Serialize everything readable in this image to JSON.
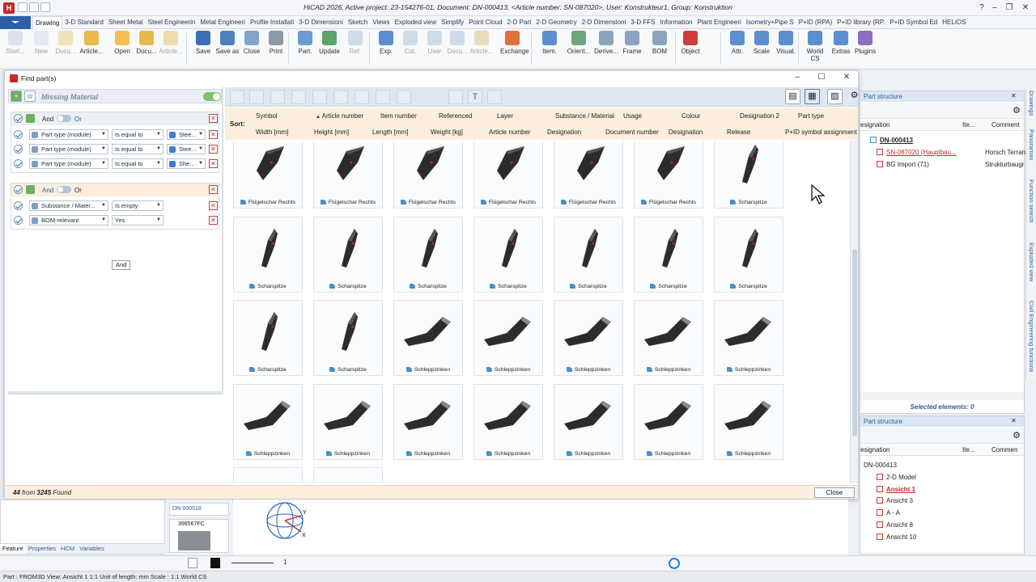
{
  "app": {
    "title": "HiCAD 2026, Active project: 23-154276-01, Document: DN-000413, <Article number: SN-087020>, User: Konstrukteur1, Group: Konstruktion"
  },
  "tabs": [
    {
      "label": "Drawing",
      "active": true
    },
    {
      "label": "3-D Standard"
    },
    {
      "label": "Sheet Metal"
    },
    {
      "label": "Steel Engineerin"
    },
    {
      "label": "Metal Engineeri"
    },
    {
      "label": "Profile Installati"
    },
    {
      "label": "3-D Dimensioni"
    },
    {
      "label": "Sketch"
    },
    {
      "label": "Views"
    },
    {
      "label": "Exploded view"
    },
    {
      "label": "Simplify"
    },
    {
      "label": "Point Cloud"
    },
    {
      "label": "2-D Part"
    },
    {
      "label": "2-D Geometry"
    },
    {
      "label": "2-D Dimensioni"
    },
    {
      "label": "3-D FFS"
    },
    {
      "label": "Information"
    },
    {
      "label": "Plant Engineeri"
    },
    {
      "label": "Isometry+Pipe S"
    },
    {
      "label": "P+ID (RPA)"
    },
    {
      "label": "P+ID library (RP."
    },
    {
      "label": "P+ID Symbol Ed"
    },
    {
      "label": "HELIOS"
    }
  ],
  "ribbon": [
    {
      "label": "Start...",
      "dim": true,
      "color": "#b9c6d6"
    },
    {
      "label": "New",
      "dim": true,
      "color": "#c7d4e3"
    },
    {
      "label": "Docu...",
      "dim": true,
      "color": "#e9c46a"
    },
    {
      "label": "Article...",
      "dim": false,
      "color": "#e9b949"
    },
    {
      "label": "Open",
      "dim": false,
      "color": "#f2c14e"
    },
    {
      "label": "Docu...",
      "dim": false,
      "color": "#e5b94a"
    },
    {
      "label": "Article...",
      "dim": true,
      "color": "#e5b94a"
    },
    {
      "label": "Save",
      "dim": false,
      "color": "#3b6fb6"
    },
    {
      "label": "Save as",
      "dim": false,
      "color": "#4d7fc1"
    },
    {
      "label": "Close",
      "dim": false,
      "color": "#7fa4cf"
    },
    {
      "label": "Print",
      "dim": false,
      "color": "#8e99a6"
    },
    {
      "label": "Part.",
      "dim": false,
      "color": "#6b9bd1"
    },
    {
      "label": "Update",
      "dim": false,
      "color": "#5aa56a"
    },
    {
      "label": "Ref.",
      "dim": true,
      "color": "#9bb7d4"
    },
    {
      "label": "Exp.",
      "dim": false,
      "color": "#5b8fd0"
    },
    {
      "label": "Cat.",
      "dim": true,
      "color": "#9bb7d4"
    },
    {
      "label": "User",
      "dim": true,
      "color": "#9bb7d4"
    },
    {
      "label": "Docu...",
      "dim": true,
      "color": "#9bb7d4"
    },
    {
      "label": "Article...",
      "dim": true,
      "color": "#d6b56a"
    },
    {
      "label": "Exchange",
      "dim": false,
      "color": "#e0713a"
    },
    {
      "label": "Item.",
      "dim": false,
      "color": "#5b8fd0"
    },
    {
      "label": "Orient...",
      "dim": false,
      "color": "#6aa67a"
    },
    {
      "label": "Derive...",
      "dim": false,
      "color": "#8aa3bf"
    },
    {
      "label": "Frame",
      "dim": false,
      "color": "#8aa3bf"
    },
    {
      "label": "BOM",
      "dim": false,
      "color": "#8aa3bf"
    },
    {
      "label": "Object",
      "dim": false,
      "color": "#d23b3b"
    },
    {
      "label": "Attr.",
      "dim": false,
      "color": "#5b8fd0"
    },
    {
      "label": "Scale",
      "dim": false,
      "color": "#5b8fd0"
    },
    {
      "label": "Visual.",
      "dim": false,
      "color": "#5b8fd0"
    },
    {
      "label": "World CS",
      "dim": false,
      "color": "#5b8fd0"
    },
    {
      "label": "Extras",
      "dim": false,
      "color": "#5b8fd0"
    },
    {
      "label": "Plugins",
      "dim": false,
      "color": "#8a6fc0"
    }
  ],
  "findwin": {
    "title": "Find part(s)",
    "panel_title": "Missing Material",
    "group1": {
      "and_label": "And",
      "or_label": "Or",
      "rows": [
        {
          "field": "Part type (module)",
          "op": "Is equal to",
          "value": "Stee..."
        },
        {
          "field": "Part type (module)",
          "op": "Is equal to",
          "value": "Stee..."
        },
        {
          "field": "Part type (module)",
          "op": "Is equal to",
          "value": "She..."
        }
      ]
    },
    "tooltip": "And",
    "group2": {
      "and_label": "And",
      "or_label": "Or",
      "rows": [
        {
          "field": "Substance / Mater...",
          "op": "Is empty",
          "value": ""
        },
        {
          "field": "BOM-relevant",
          "op": "Yes",
          "value": ""
        }
      ]
    },
    "sort": {
      "label": "Sort:",
      "row1": [
        "Symbol",
        "Article number",
        "Item number",
        "Referenced",
        "Layer",
        "Substance / Material",
        "Usage",
        "Colour",
        "Designation 2",
        "Part type"
      ],
      "row2": [
        "Width [mm]",
        "Height [mm]",
        "Length [mm]",
        "Weight [kg]",
        "Article number",
        "Designation",
        "Document number",
        "Designation",
        "Release",
        "P+ID symbol assignment"
      ]
    },
    "results": [
      {
        "label": "Flügelschar Rechts",
        "shape": "wing"
      },
      {
        "label": "Flügelschar Rechts",
        "shape": "wing"
      },
      {
        "label": "Flügelschar Rechts",
        "shape": "wing"
      },
      {
        "label": "Flügelschar Rechts",
        "shape": "wing"
      },
      {
        "label": "Flügelschar Rechts",
        "shape": "wing"
      },
      {
        "label": "Flügelschar Rechts",
        "shape": "wing"
      },
      {
        "label": "Scharspitze",
        "shape": "tip"
      },
      {
        "label": "Scharspitze",
        "shape": "tip"
      },
      {
        "label": "Scharspitze",
        "shape": "tip"
      },
      {
        "label": "Scharspitze",
        "shape": "tip"
      },
      {
        "label": "Scharspitze",
        "shape": "tip"
      },
      {
        "label": "Scharspitze",
        "shape": "tip"
      },
      {
        "label": "Scharspitze",
        "shape": "tip"
      },
      {
        "label": "Scharspitze",
        "shape": "tip"
      },
      {
        "label": "Scharspitze",
        "shape": "tip"
      },
      {
        "label": "Scharspitze",
        "shape": "tip"
      },
      {
        "label": "Schleppzinken",
        "shape": "tine"
      },
      {
        "label": "Schleppzinken",
        "shape": "tine"
      },
      {
        "label": "Schleppzinken",
        "shape": "tine"
      },
      {
        "label": "Schleppzinken",
        "shape": "tine"
      },
      {
        "label": "Schleppzinken",
        "shape": "tine"
      },
      {
        "label": "Schleppzinken",
        "shape": "tine"
      },
      {
        "label": "Schleppzinken",
        "shape": "tine"
      },
      {
        "label": "Schleppzinken",
        "shape": "tine"
      },
      {
        "label": "Schleppzinken",
        "shape": "tine"
      },
      {
        "label": "Schleppzinken",
        "shape": "tine"
      },
      {
        "label": "Schleppzinken",
        "shape": "tine"
      },
      {
        "label": "Schleppzinken",
        "shape": "tine"
      },
      {
        "label": "",
        "shape": "blank"
      },
      {
        "label": "",
        "shape": "blank"
      }
    ],
    "found_count": "44",
    "found_from": "from",
    "found_total": "3245",
    "found_label": "Found",
    "close_label": "Close"
  },
  "partstructure1": {
    "title": "Part structure",
    "cols": [
      "esignation",
      "Ite...",
      "Comment"
    ],
    "rows": [
      {
        "text": "DN-000413",
        "comment": ""
      },
      {
        "text": "SN-087020 (Hauptbau...",
        "comment": "Horsch Terran"
      },
      {
        "text": "BG Import (71)",
        "comment": "Strukturbaugr"
      }
    ],
    "selected": "Selected elements: 0"
  },
  "partstructure2": {
    "title": "Part structure",
    "cols": [
      "esignation",
      "Ite...",
      "Commen"
    ],
    "rows": [
      "DN-000413",
      "2-D Model",
      "Ansicht 1",
      "Ansicht 3",
      "A - A",
      "Ansicht 8",
      "Ansicht 10"
    ]
  },
  "sidetabs": [
    "Drawings",
    "Panoramas",
    "Function search",
    "Exploded view",
    "Civil Engineering functions"
  ],
  "bottom": {
    "tabs": [
      "Feature",
      "Properties",
      "HCM",
      "Variables"
    ],
    "thumb1": "DN-000518",
    "thumb2": "398567FC",
    "line_width": "1"
  },
  "footer": "Part : FROM3D View: Ansicht 1 1:1 Unit of length: mm Scale : 1:1  World CS"
}
